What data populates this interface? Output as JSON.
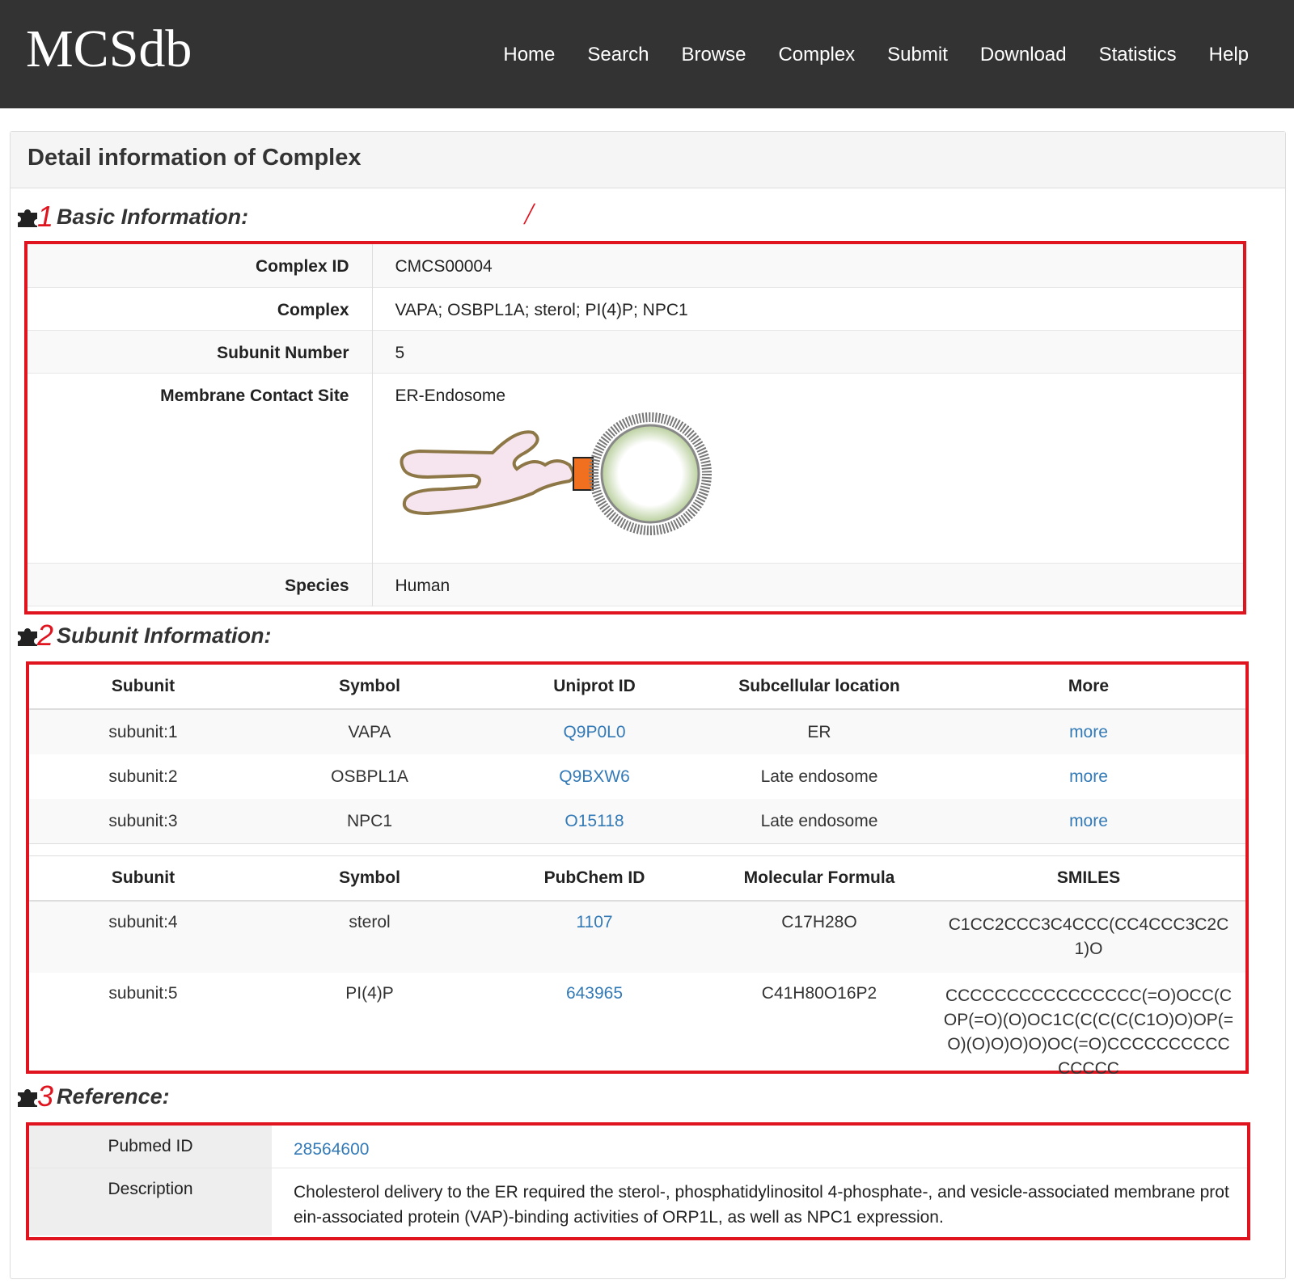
{
  "brand": "MCSdb",
  "nav": [
    "Home",
    "Search",
    "Browse",
    "Complex",
    "Submit",
    "Download",
    "Statistics",
    "Help"
  ],
  "page_title": "Detail information of Complex",
  "sections": {
    "basic": {
      "num": "1",
      "title": "Basic Information:"
    },
    "subunit": {
      "num": "2",
      "title": "Subunit Information:"
    },
    "reference": {
      "num": "3",
      "title": "Reference:"
    }
  },
  "basic": {
    "complex_id_label": "Complex ID",
    "complex_id": "CMCS00004",
    "complex_label": "Complex",
    "complex": "VAPA; OSBPL1A; sterol; PI(4)P; NPC1",
    "subunit_number_label": "Subunit Number",
    "subunit_number": "5",
    "mcs_label": "Membrane Contact Site",
    "mcs": "ER-Endosome",
    "species_label": "Species",
    "species": "Human"
  },
  "protein_headers": [
    "Subunit",
    "Symbol",
    "Uniprot ID",
    "Subcellular location",
    "More"
  ],
  "proteins": [
    {
      "subunit": "subunit:1",
      "symbol": "VAPA",
      "uniprot": "Q9P0L0",
      "location": "ER",
      "more": "more"
    },
    {
      "subunit": "subunit:2",
      "symbol": "OSBPL1A",
      "uniprot": "Q9BXW6",
      "location": "Late endosome",
      "more": "more"
    },
    {
      "subunit": "subunit:3",
      "symbol": "NPC1",
      "uniprot": "O15118",
      "location": "Late endosome",
      "more": "more"
    }
  ],
  "compound_headers": [
    "Subunit",
    "Symbol",
    "PubChem ID",
    "Molecular Formula",
    "SMILES"
  ],
  "compounds": [
    {
      "subunit": "subunit:4",
      "symbol": "sterol",
      "pubchem": "1107",
      "formula": "C17H28O",
      "smiles": "C1CC2CCC3C4CCC(CC4CCC3C2C1)O"
    },
    {
      "subunit": "subunit:5",
      "symbol": "PI(4)P",
      "pubchem": "643965",
      "formula": "C41H80O16P2",
      "smiles": "CCCCCCCCCCCCCCCC(=O)OCC(COP(=O)(O)OC1C(C(C(C(C1O)O)OP(=O)(O)O)O)O)OC(=O)CCCCCCCCCCCCCCC"
    }
  ],
  "reference": {
    "pubmed_label": "Pubmed ID",
    "pubmed": "28564600",
    "description_label": "Description",
    "description": "Cholesterol delivery to the ER required the sterol-, phosphatidylinositol 4-phosphate-, and vesicle-associated membrane protein-associated protein (VAP)-binding activities of ORP1L, as well as NPC1 expression."
  },
  "colors": {
    "navbar": "#333333",
    "link": "#337ab7",
    "highlight": "#e0141e"
  }
}
